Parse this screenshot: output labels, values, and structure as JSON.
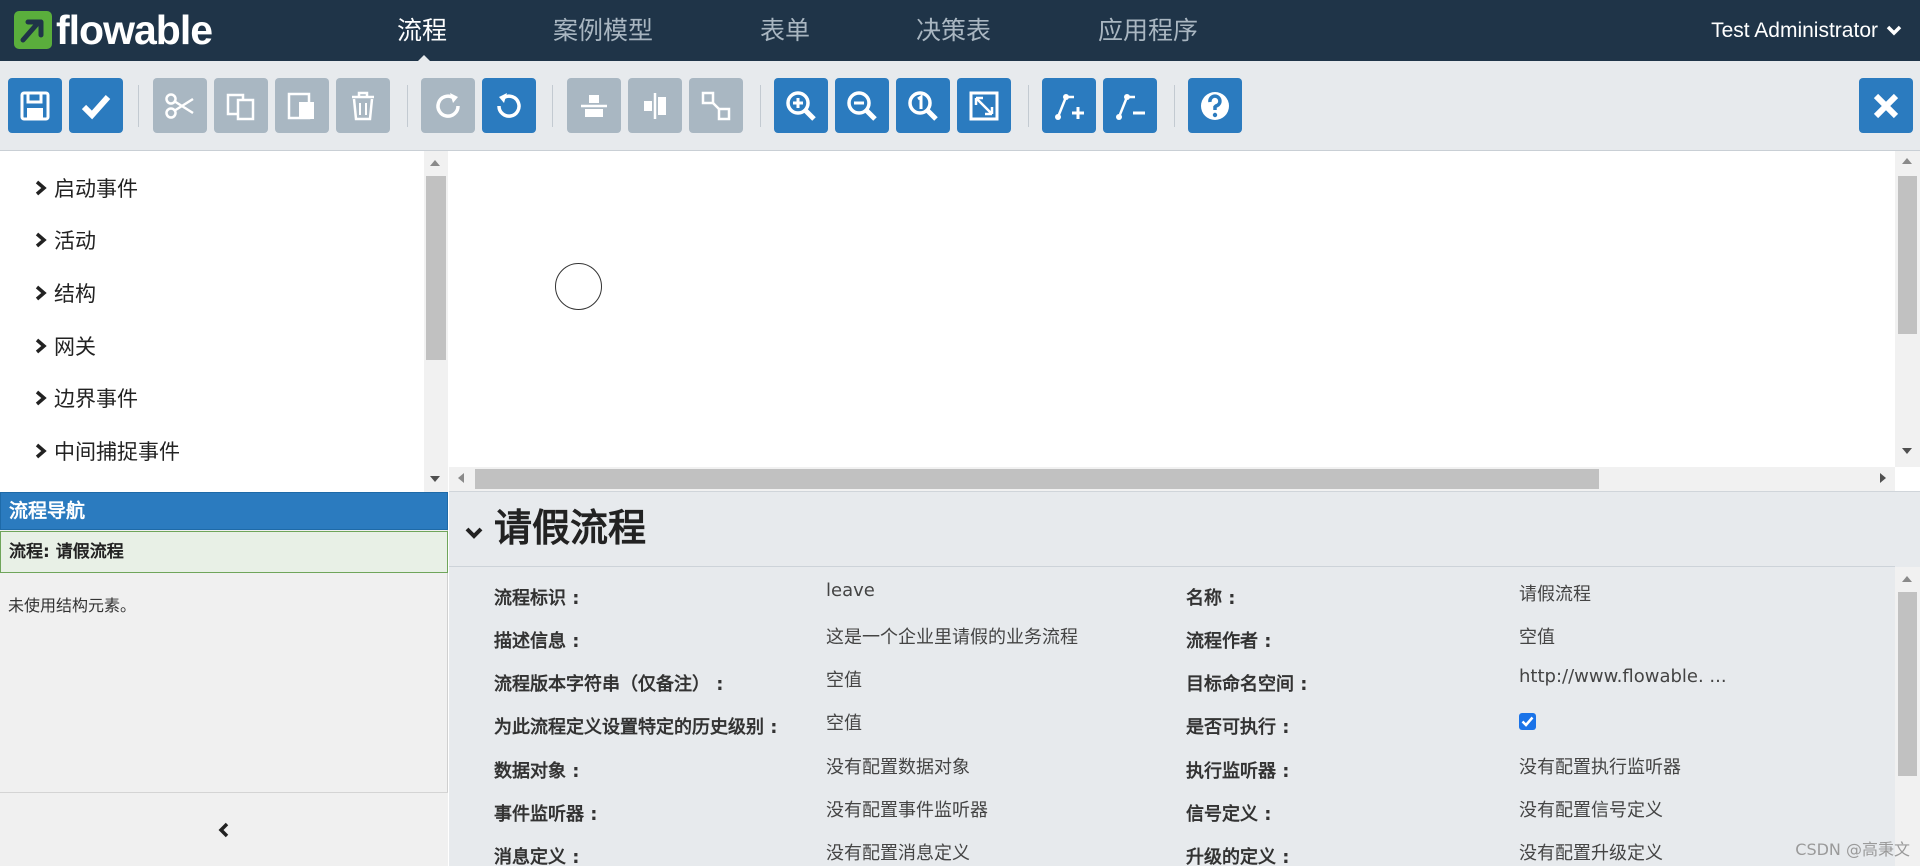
{
  "navbar": {
    "logo_text": "flowable",
    "menu": [
      {
        "label": "流程",
        "active": true
      },
      {
        "label": "案例模型",
        "active": false
      },
      {
        "label": "表单",
        "active": false
      },
      {
        "label": "决策表",
        "active": false
      },
      {
        "label": "应用程序",
        "active": false
      }
    ],
    "user": "Test Administrator"
  },
  "toolbar": {
    "buttons": [
      {
        "icon": "save-icon",
        "enabled": true
      },
      {
        "icon": "validate-check-icon",
        "enabled": true
      },
      {
        "icon": "cut-icon",
        "enabled": false
      },
      {
        "icon": "copy-icon",
        "enabled": false
      },
      {
        "icon": "paste-icon",
        "enabled": false
      },
      {
        "icon": "delete-icon",
        "enabled": false
      },
      {
        "icon": "redo-icon",
        "enabled": false
      },
      {
        "icon": "undo-icon",
        "enabled": true
      },
      {
        "icon": "align-horizontal-icon",
        "enabled": false
      },
      {
        "icon": "align-vertical-icon",
        "enabled": false
      },
      {
        "icon": "same-size-icon",
        "enabled": false
      },
      {
        "icon": "zoom-in-icon",
        "enabled": true
      },
      {
        "icon": "zoom-out-icon",
        "enabled": true
      },
      {
        "icon": "zoom-actual-icon",
        "enabled": true
      },
      {
        "icon": "zoom-fit-icon",
        "enabled": true
      },
      {
        "icon": "add-bendpoint-icon",
        "enabled": true
      },
      {
        "icon": "remove-bendpoint-icon",
        "enabled": true
      },
      {
        "icon": "help-icon",
        "enabled": true
      },
      {
        "icon": "close-icon",
        "enabled": true
      }
    ]
  },
  "palette": {
    "groups": [
      "启动事件",
      "活动",
      "结构",
      "网关",
      "边界事件",
      "中间捕捉事件"
    ]
  },
  "navigator": {
    "title": "流程导航",
    "process": "流程: 请假流程",
    "empty_text": "未使用结构元素。"
  },
  "properties": {
    "title": "请假流程",
    "rows": [
      {
        "label": "流程标识 :",
        "value": "leave",
        "label2": "名称 :",
        "value2": "请假流程"
      },
      {
        "label": "描述信息 :",
        "value": "这是一个企业里请假的业务流程",
        "label2": "流程作者 :",
        "value2": "空值"
      },
      {
        "label": "流程版本字符串（仅备注） :",
        "value": "空值",
        "label2": "目标命名空间 :",
        "value2": "http://www.flowable. ..."
      },
      {
        "label": "为此流程定义设置特定的历史级别 :",
        "value": "空值",
        "label2": "是否可执行 :",
        "value2": ""
      },
      {
        "label": "数据对象 :",
        "value": "没有配置数据对象",
        "label2": "执行监听器 :",
        "value2": "没有配置执行监听器"
      },
      {
        "label": "事件监听器 :",
        "value": "没有配置事件监听器",
        "label2": "信号定义 :",
        "value2": "没有配置信号定义"
      },
      {
        "label": "消息定义 :",
        "value": "没有配置消息定义",
        "label2": "升级的定义 :",
        "value2": "没有配置升级定义"
      }
    ],
    "is_executable": true
  },
  "watermark": "CSDN @高秉文"
}
